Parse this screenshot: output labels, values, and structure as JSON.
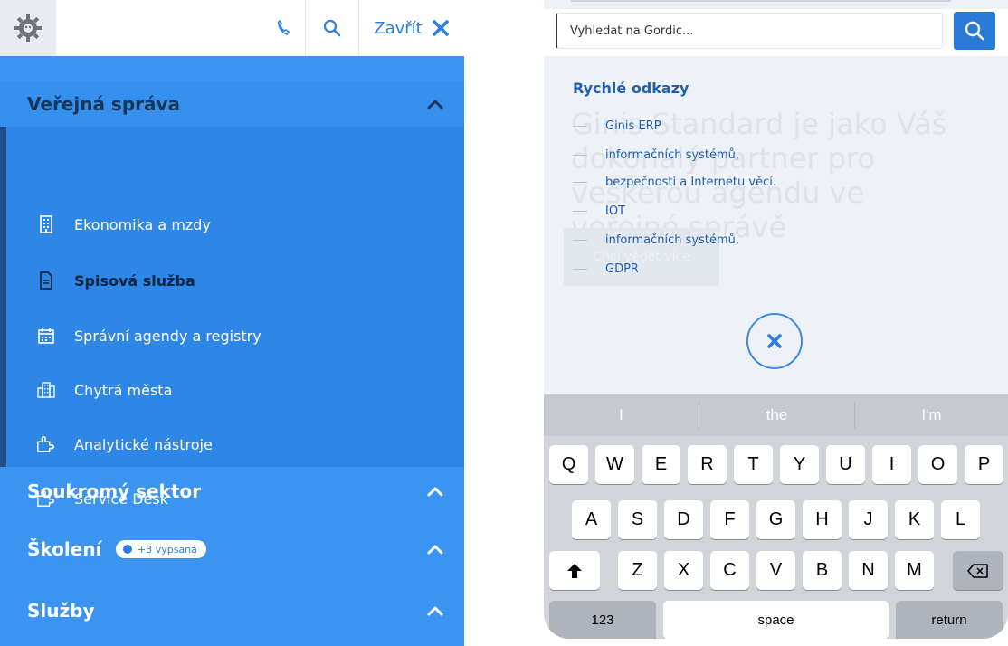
{
  "header": {
    "logo_icon": "gear-gordic-logo",
    "phone_icon": "phone-icon",
    "search_icon": "search-icon",
    "close_label": "Zavřít",
    "close_icon": "close-icon"
  },
  "menu": {
    "sections": [
      {
        "label": "Veřejná správa",
        "expanded": true,
        "chevron": "chevron-up-icon"
      },
      {
        "label": "Soukromý sektor",
        "chevron": "chevron-up-icon"
      },
      {
        "label": "Školení",
        "badge": "+3 vypsaná",
        "chevron": "chevron-up-icon"
      },
      {
        "label": "Služby",
        "chevron": "chevron-up-icon"
      }
    ],
    "items": [
      {
        "label": "Ekonomika a mzdy",
        "icon": "building-icon"
      },
      {
        "label": "Spisová služba",
        "icon": "document-icon",
        "active": true
      },
      {
        "label": "Správní agendy a registry",
        "icon": "calendar-icon"
      },
      {
        "label": "Chytrá města",
        "icon": "city-icon"
      },
      {
        "label": "Analytické nástroje",
        "icon": "puzzle-icon"
      },
      {
        "label": "Service Desk",
        "icon": "puzzle-icon"
      }
    ]
  },
  "search": {
    "placeholder": "Vyhledat na Gordic..."
  },
  "quick_links": {
    "title": "Rychlé odkazy",
    "items": [
      "Ginis ERP",
      "informačních systémů,",
      "bezpečnosti a Internetu věcí.",
      "IOT",
      "informačních systémů,",
      "GDPR"
    ]
  },
  "background": {
    "text": "Ginis Standard je jako Váš dokonalý partner pro veškerou agendu ve veřejné správě",
    "button": "Chci vědět více"
  },
  "keyboard": {
    "suggestions": [
      "I",
      "the",
      "I'm"
    ],
    "row1": [
      "Q",
      "W",
      "E",
      "R",
      "T",
      "Y",
      "U",
      "I",
      "O",
      "P"
    ],
    "row2": [
      "A",
      "S",
      "D",
      "F",
      "G",
      "H",
      "J",
      "K",
      "L"
    ],
    "row3": [
      "Z",
      "X",
      "C",
      "V",
      "B",
      "N",
      "M"
    ],
    "numbers_key": "123",
    "space_key": "space",
    "return_key": "return"
  },
  "colors": {
    "menu_blue": "#3b94f0",
    "submenu_blue": "#2e86e6",
    "accent": "#2a7fe0"
  }
}
